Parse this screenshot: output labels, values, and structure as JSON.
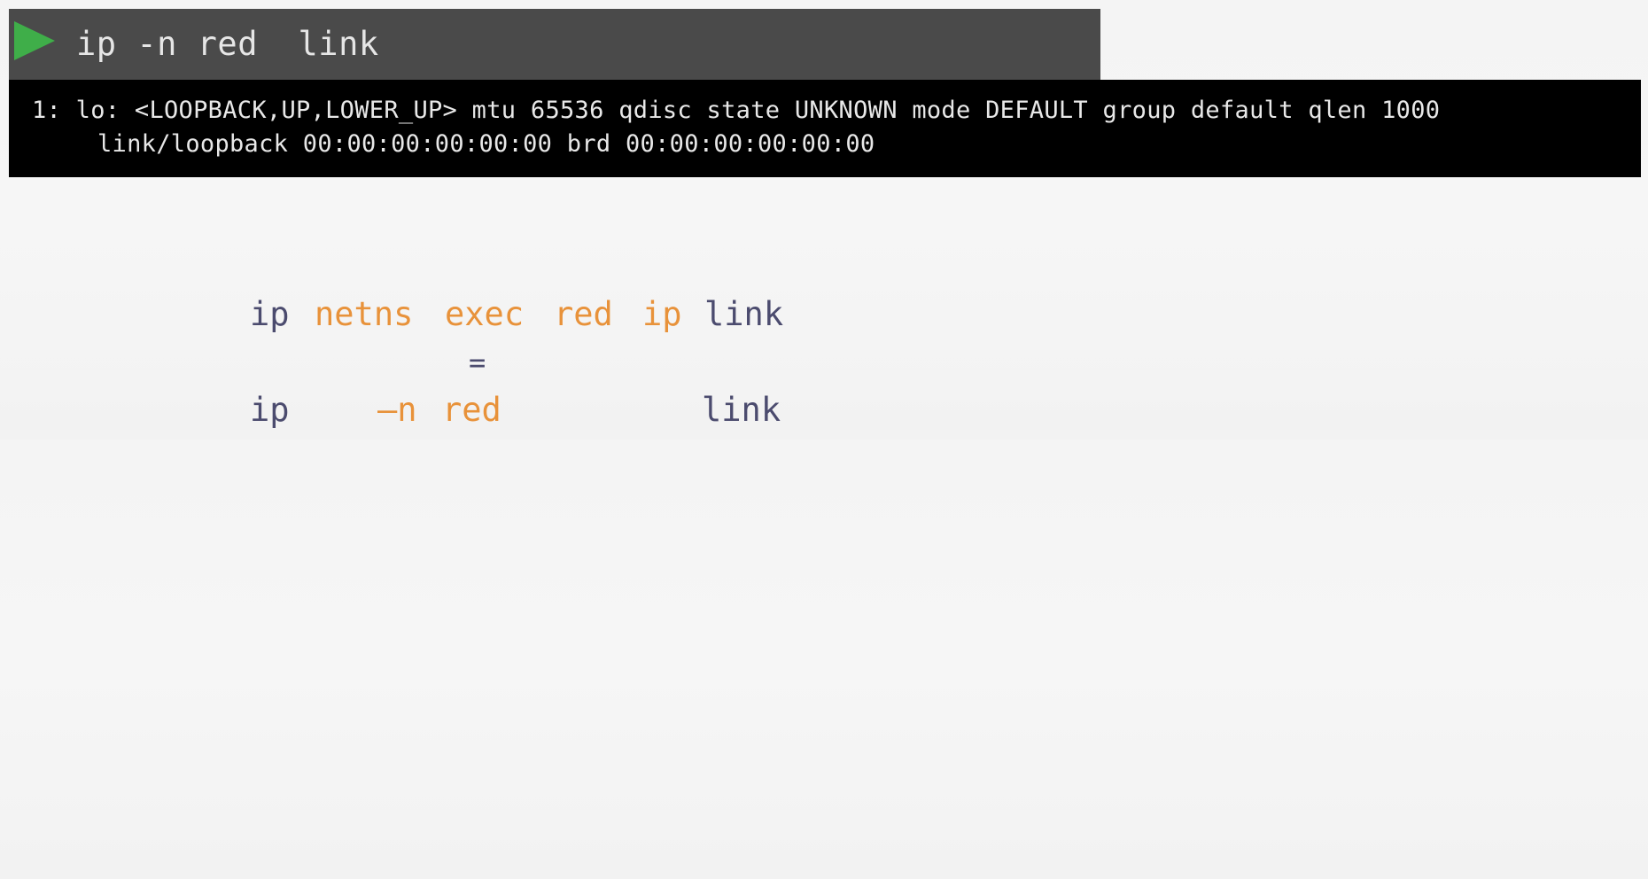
{
  "command_bar": {
    "run_icon": "play-icon",
    "run_icon_color": "#3fae49",
    "command": "ip -n red  link"
  },
  "terminal": {
    "lines": [
      "1: lo: <LOOPBACK,UP,LOWER_UP> mtu 65536 qdisc state UNKNOWN mode DEFAULT group default qlen 1000",
      "link/loopback 00:00:00:00:00:00 brd 00:00:00:00:00:00"
    ]
  },
  "comparison": {
    "line1": {
      "ip": "ip",
      "netns": "netns",
      "exec": "exec",
      "red": "red",
      "ip2": "ip",
      "link": "link"
    },
    "equals": "=",
    "line2": {
      "ip": "ip",
      "flag": "–n",
      "red": "red",
      "link": "link"
    },
    "colors": {
      "keyword": "#4b4b6e",
      "highlight": "#e8923a"
    }
  }
}
